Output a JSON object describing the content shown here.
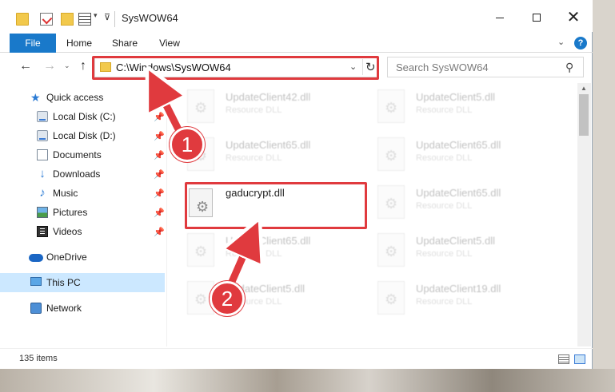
{
  "window": {
    "title": "SysWOW64"
  },
  "ribbon": {
    "tabs": [
      {
        "label": "File"
      },
      {
        "label": "Home"
      },
      {
        "label": "Share"
      },
      {
        "label": "View"
      }
    ],
    "help": "?"
  },
  "address": {
    "path": "C:\\Windows\\SysWOW64",
    "search_placeholder": "Search SysWOW64"
  },
  "sidebar": {
    "items": [
      {
        "label": "Quick access",
        "icon": "star-icon"
      },
      {
        "label": "Local Disk (C:)",
        "icon": "disk-icon",
        "pinned": true
      },
      {
        "label": "Local Disk (D:)",
        "icon": "disk-icon",
        "pinned": true
      },
      {
        "label": "Documents",
        "icon": "documents-icon",
        "pinned": true
      },
      {
        "label": "Downloads",
        "icon": "download-icon",
        "pinned": true
      },
      {
        "label": "Music",
        "icon": "music-icon",
        "pinned": true
      },
      {
        "label": "Pictures",
        "icon": "pictures-icon",
        "pinned": true
      },
      {
        "label": "Videos",
        "icon": "videos-icon",
        "pinned": true
      },
      {
        "label": "OneDrive",
        "icon": "cloud-icon"
      },
      {
        "label": "This PC",
        "icon": "computer-icon",
        "selected": true
      },
      {
        "label": "Network",
        "icon": "network-icon"
      }
    ]
  },
  "files": [
    {
      "name": "UpdateClient42.dll",
      "type": "Resource DLL"
    },
    {
      "name": "UpdateClient5.dll",
      "type": "Resource DLL"
    },
    {
      "name": "UpdateClient65.dll",
      "type": "Resource DLL"
    },
    {
      "name": "UpdateClient65.dll",
      "type": "Resource DLL"
    },
    {
      "name": "gaducrypt.dll",
      "type": ""
    },
    {
      "name": "UpdateClient65.dll",
      "type": "Resource DLL"
    },
    {
      "name": "UpdateClient65.dll",
      "type": "Resource DLL"
    },
    {
      "name": "UpdateClient5.dll",
      "type": "Resource DLL"
    },
    {
      "name": "UpdateClient5.dll",
      "type": "Resource DLL"
    },
    {
      "name": "UpdateClient19.dll",
      "type": "Resource DLL"
    }
  ],
  "status": {
    "item_count": "135 items"
  },
  "annotations": {
    "step1": "1",
    "step2": "2",
    "accent_color": "#e03a3e"
  }
}
